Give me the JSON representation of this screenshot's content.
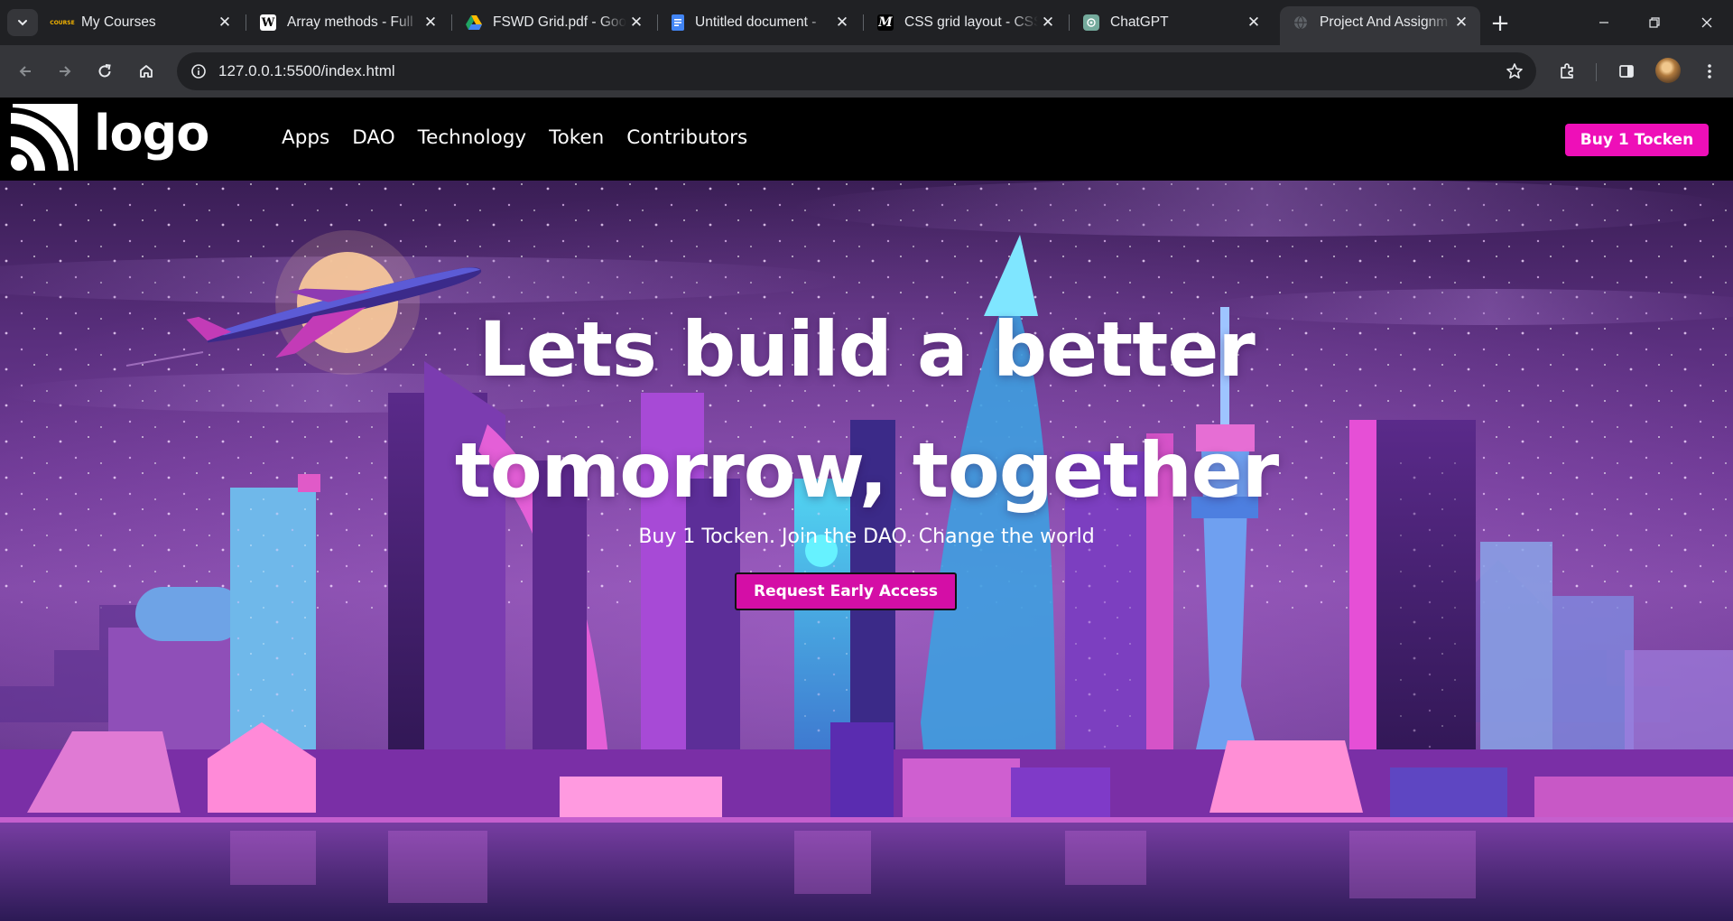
{
  "browser": {
    "tabs": [
      {
        "title": "My Courses",
        "favicon": "course-favicon",
        "favicon_color": "#202124",
        "favicon_glyph": "▪"
      },
      {
        "title": "Array methods - Full",
        "favicon": "wikipedia-favicon",
        "favicon_color": "#ffffff",
        "favicon_glyph": "W"
      },
      {
        "title": "FSWD Grid.pdf - Goo",
        "favicon": "google-drive-favicon",
        "favicon_color": "#1fa463",
        "favicon_glyph": "▲"
      },
      {
        "title": "Untitled document -",
        "favicon": "google-docs-favicon",
        "favicon_color": "#4285f4",
        "favicon_glyph": "≡"
      },
      {
        "title": "CSS grid layout - CSS",
        "favicon": "mdn-favicon",
        "favicon_color": "#000000",
        "favicon_glyph": "M"
      },
      {
        "title": "ChatGPT",
        "favicon": "chatgpt-favicon",
        "favicon_color": "#74aa9c",
        "favicon_glyph": "✿"
      },
      {
        "title": "Project And Assignm",
        "favicon": "globe-favicon",
        "favicon_color": "#5f6368",
        "favicon_glyph": "◍",
        "active": true
      }
    ],
    "url": "127.0.0.1:5500/index.html"
  },
  "site": {
    "logo_text": "logo",
    "nav": [
      "Apps",
      "DAO",
      "Technology",
      "Token",
      "Contributors"
    ],
    "buy_button": "Buy 1 Tocken",
    "accent_color": "#ee0fb8"
  },
  "hero": {
    "title_line1": "Lets build a better",
    "title_line2": "tomorrow, together",
    "subtitle": "Buy 1 Tocken. Join the DAO. Change the world",
    "cta": "Request Early Access"
  }
}
